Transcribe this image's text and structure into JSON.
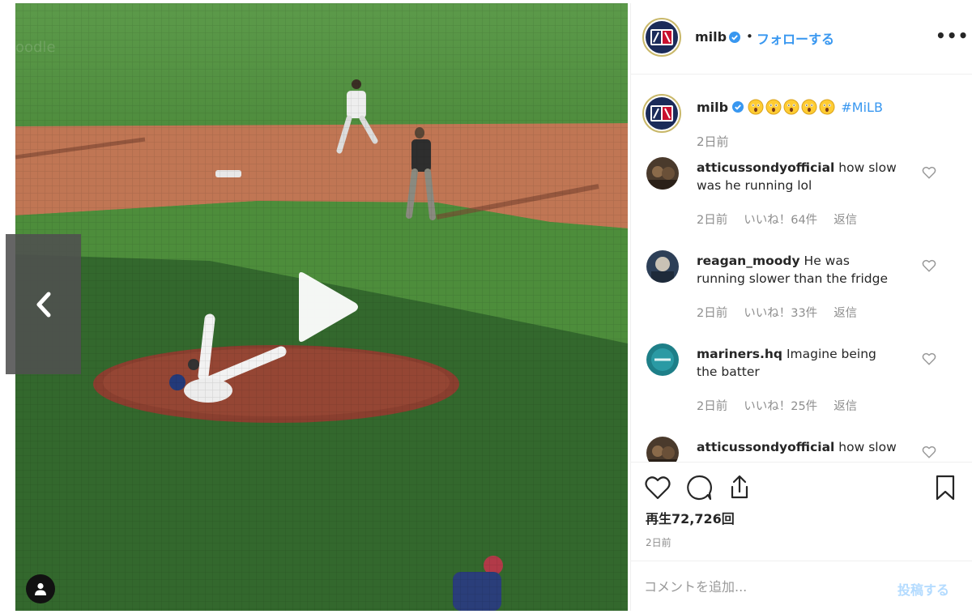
{
  "post": {
    "username": "milb",
    "follow_separator": "•",
    "follow_label": "フォローする",
    "more_label": "•••",
    "caption_hashtag": "#MiLB",
    "caption_emoji": "astonished-face-icon",
    "caption_time": "2日前"
  },
  "comments": [
    {
      "username": "atticussondyofficial",
      "text": "how slow was he running lol",
      "time": "2日前",
      "likes": "いいね！64件",
      "reply": "返信"
    },
    {
      "username": "reagan_moody",
      "text": "He was running slower than the fridge",
      "time": "2日前",
      "likes": "いいね！33件",
      "reply": "返信"
    },
    {
      "username": "mariners.hq",
      "text": "Imagine being the batter",
      "time": "2日前",
      "likes": "いいね！25件",
      "reply": "返信"
    },
    {
      "username": "atticussondyofficial",
      "text": "how slow",
      "time": "",
      "likes": "",
      "reply": ""
    }
  ],
  "stats": {
    "views": "再生72,726回",
    "posted": "2日前"
  },
  "add_comment": {
    "placeholder": "コメントを追加...",
    "post_label": "投稿する"
  },
  "colors": {
    "link_blue": "#3897f0",
    "muted": "#8e8e8e",
    "field_green": "#4e8a3f",
    "infield_dirt": "#b86d4e"
  },
  "icons": [
    "play-icon",
    "chevron-left-icon",
    "chevron-right-icon",
    "verified-badge-icon",
    "heart-icon",
    "comment-icon",
    "share-icon",
    "bookmark-icon",
    "user-tag-icon"
  ]
}
